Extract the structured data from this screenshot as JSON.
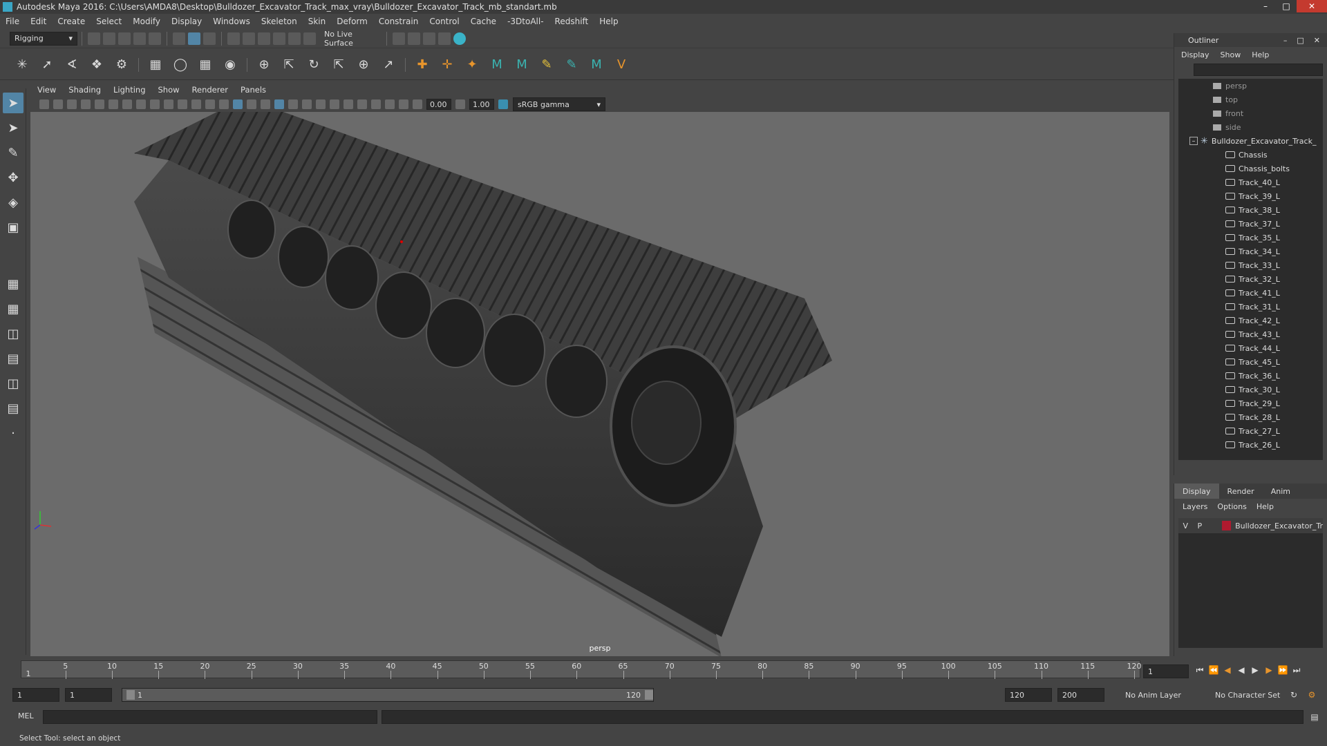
{
  "window": {
    "title": "Autodesk Maya 2016: C:\\Users\\AMDA8\\Desktop\\Bulldozer_Excavator_Track_max_vray\\Bulldozer_Excavator_Track_mb_standart.mb"
  },
  "menubar": [
    "File",
    "Edit",
    "Create",
    "Select",
    "Modify",
    "Display",
    "Windows",
    "Skeleton",
    "Skin",
    "Deform",
    "Constrain",
    "Control",
    "Cache",
    "-3DtoAll-",
    "Redshift",
    "Help"
  ],
  "statusline": {
    "mode": "Rigging",
    "live_surface": "No Live Surface"
  },
  "panel_menu": [
    "View",
    "Shading",
    "Lighting",
    "Show",
    "Renderer",
    "Panels"
  ],
  "panel_toolbar": {
    "exposure": "0.00",
    "gamma": "1.00",
    "color_space": "sRGB gamma"
  },
  "viewport": {
    "camera_label": "persp"
  },
  "outliner": {
    "title": "Outliner",
    "menu": [
      "Display",
      "Show",
      "Help"
    ],
    "cameras": [
      "persp",
      "top",
      "front",
      "side"
    ],
    "group": "Bulldozer_Excavator_Track_",
    "children": [
      "Chassis",
      "Chassis_bolts",
      "Track_40_L",
      "Track_39_L",
      "Track_38_L",
      "Track_37_L",
      "Track_35_L",
      "Track_34_L",
      "Track_33_L",
      "Track_32_L",
      "Track_41_L",
      "Track_31_L",
      "Track_42_L",
      "Track_43_L",
      "Track_44_L",
      "Track_45_L",
      "Track_36_L",
      "Track_30_L",
      "Track_29_L",
      "Track_28_L",
      "Track_27_L",
      "Track_26_L"
    ]
  },
  "layers": {
    "tabs": [
      "Display",
      "Render",
      "Anim"
    ],
    "menu": [
      "Layers",
      "Options",
      "Help"
    ],
    "row": {
      "v": "V",
      "p": "P",
      "name": "Bulldozer_Excavator_Tr"
    }
  },
  "timeline": {
    "ticks": [
      "5",
      "10",
      "15",
      "20",
      "25",
      "30",
      "35",
      "40",
      "45",
      "50",
      "55",
      "60",
      "65",
      "70",
      "75",
      "80",
      "85",
      "90",
      "95",
      "100",
      "105",
      "110",
      "115",
      "120"
    ],
    "current_frame": "1",
    "start_marker": "1"
  },
  "range": {
    "start": "1",
    "start2": "1",
    "slider_start": "1",
    "slider_end": "120",
    "end": "120",
    "end2": "200",
    "anim_layer": "No Anim Layer",
    "char_set": "No Character Set"
  },
  "cmdline": {
    "label": "MEL"
  },
  "helpline": {
    "text": "Select Tool: select an object"
  }
}
